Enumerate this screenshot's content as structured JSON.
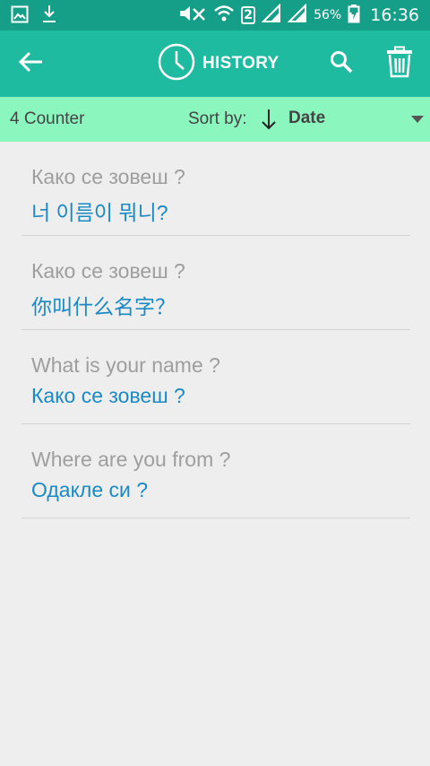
{
  "status_bar": {
    "sim_label": "2",
    "battery_percent": "56%",
    "time": "16:36",
    "icons": [
      "gallery-icon",
      "download-icon",
      "mute-icon",
      "wifi-icon",
      "signal-icon",
      "signal-icon",
      "battery-charging-icon"
    ]
  },
  "app_bar": {
    "title": "HISTORY",
    "title_icon": "clock-icon",
    "back_icon": "arrow-left-icon",
    "search_icon": "search-icon",
    "delete_icon": "trash-icon"
  },
  "sort_bar": {
    "counter": "4 Counter",
    "sort_label": "Sort by:",
    "sort_value": "Date",
    "sort_icon": "arrow-down-icon"
  },
  "history": {
    "items": [
      {
        "source": "Како се зовеш ?",
        "translation": "너 이름이 뭐니?"
      },
      {
        "source": "Како се зовеш ?",
        "translation": "你叫什么名字？"
      },
      {
        "source": "What is your name ?",
        "translation": "Како се зовеш ?"
      },
      {
        "source": "Where are you from ?",
        "translation": "Одакле си ?"
      }
    ]
  },
  "colors": {
    "status_bar": "#169f88",
    "app_bar": "#1fbba0",
    "sort_bar": "#8bf6be",
    "source_text": "#9e9e9e",
    "translation_text": "#1b8ac4",
    "background": "#eeeeee"
  }
}
